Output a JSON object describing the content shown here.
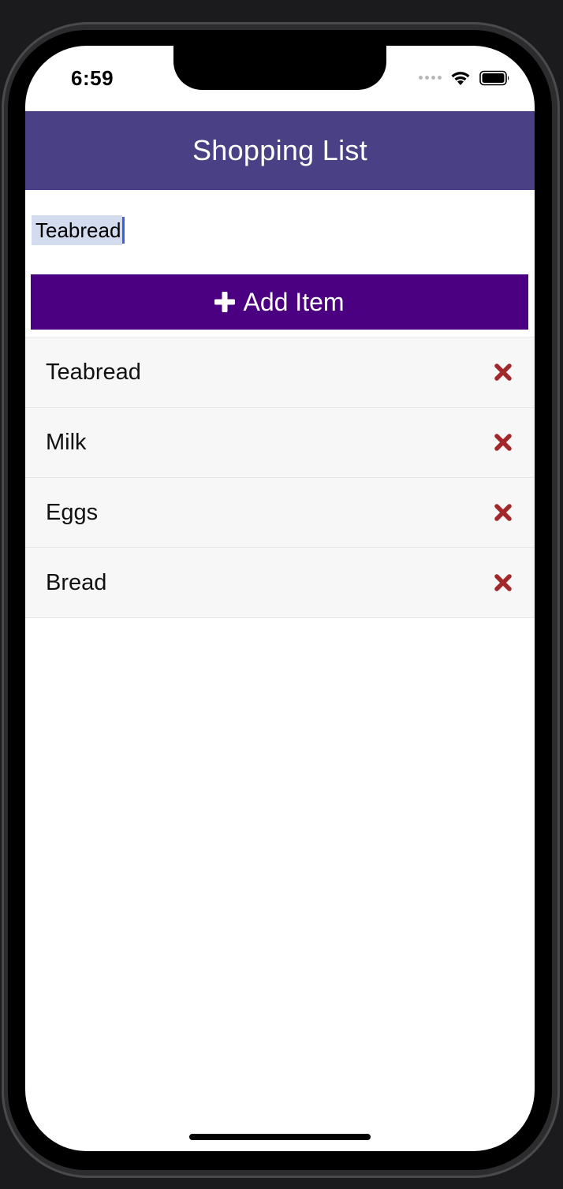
{
  "status_bar": {
    "time": "6:59",
    "icons": [
      "signal-dots-icon",
      "wifi-icon",
      "battery-icon"
    ]
  },
  "header": {
    "title": "Shopping List"
  },
  "input": {
    "value": "Teabread"
  },
  "add_button": {
    "icon": "plus-icon",
    "label": "Add Item"
  },
  "items": [
    {
      "label": "Teabread",
      "delete_icon": "close-icon"
    },
    {
      "label": "Milk",
      "delete_icon": "close-icon"
    },
    {
      "label": "Eggs",
      "delete_icon": "close-icon"
    },
    {
      "label": "Bread",
      "delete_icon": "close-icon"
    }
  ],
  "colors": {
    "header_bg": "#4a4086",
    "button_bg": "#4b0082",
    "delete": "#a3282c",
    "selection": "#d3dcee",
    "caret": "#3b62d9"
  }
}
